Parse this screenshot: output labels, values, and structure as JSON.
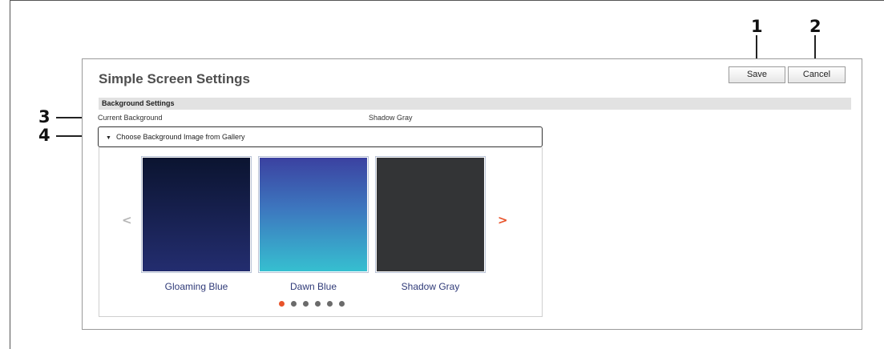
{
  "callouts": [
    "1",
    "2",
    "3",
    "4"
  ],
  "panel": {
    "title": "Simple Screen Settings",
    "save_label": "Save",
    "cancel_label": "Cancel"
  },
  "background_settings": {
    "section_label": "Background Settings",
    "current_label": "Current Background",
    "current_value": "Shadow Gray"
  },
  "gallery": {
    "toggle_label": "Choose Background Image from Gallery",
    "toggle_icon": "triangle-down-icon",
    "prev_glyph": "<",
    "next_glyph": ">",
    "items": [
      {
        "label": "Gloaming Blue"
      },
      {
        "label": "Dawn Blue"
      },
      {
        "label": "Shadow Gray"
      }
    ],
    "pages": 6,
    "active_page": 1
  },
  "colors": {
    "accent": "#e8532a",
    "title_gray": "#4f4f4f",
    "thumb_label": "#2f3a78"
  }
}
